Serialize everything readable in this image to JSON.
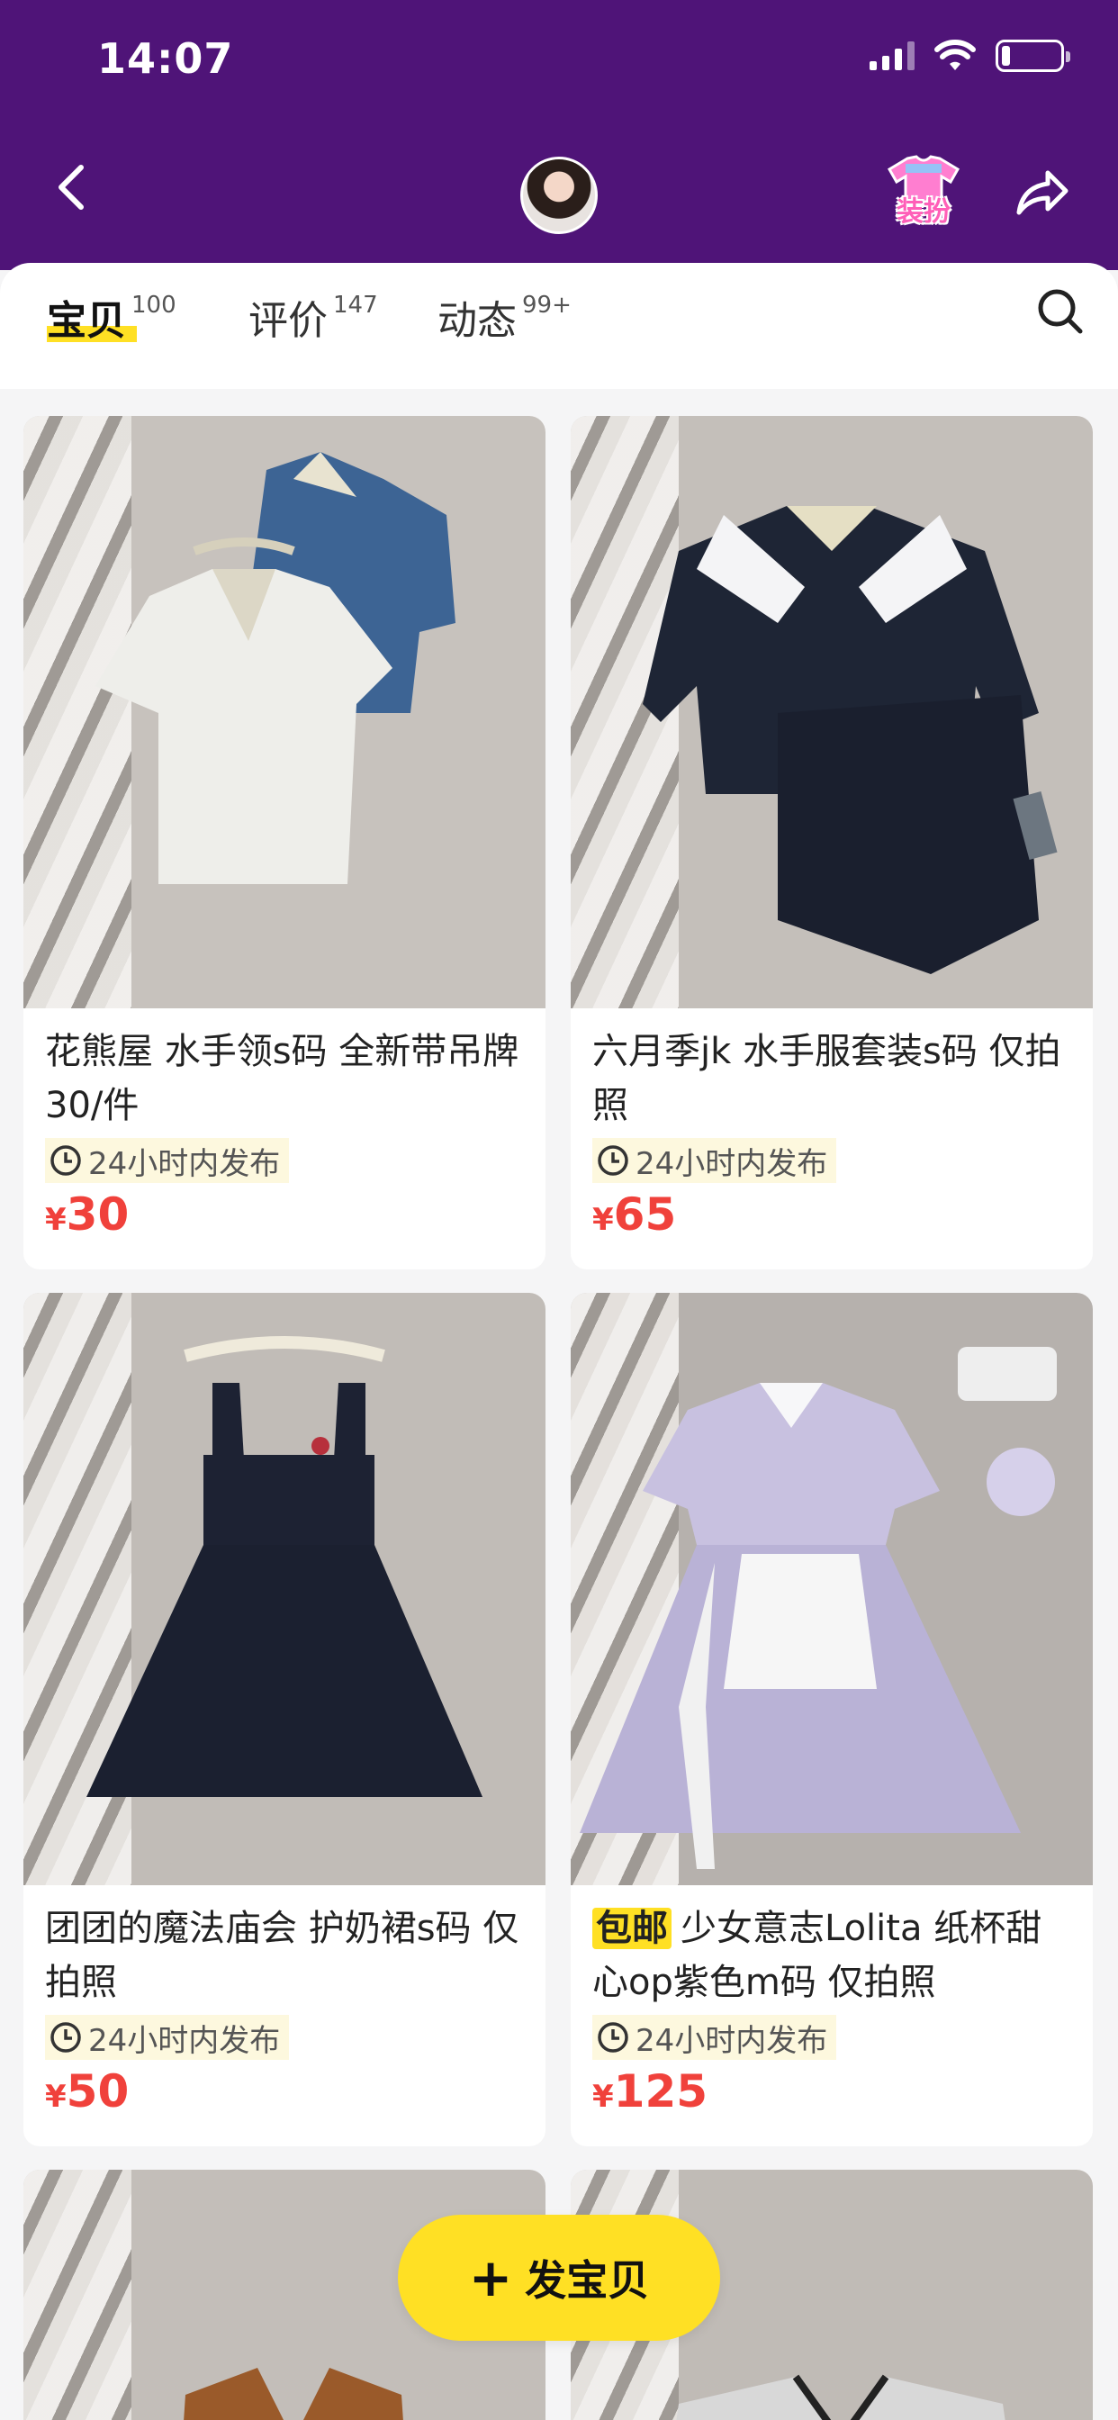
{
  "status": {
    "time": "14:07"
  },
  "header": {
    "dress_label": "装扮"
  },
  "tabs": [
    {
      "label": "宝贝",
      "count": "100"
    },
    {
      "label": "评价",
      "count": "147"
    },
    {
      "label": "动态",
      "count": "99+"
    }
  ],
  "items": [
    {
      "title": "花熊屋 水手领s码 全新带吊牌30/件",
      "time": "24小时内发布",
      "currency": "¥",
      "price": "30"
    },
    {
      "title": "六月季jk 水手服套装s码 仅拍照",
      "time": "24小时内发布",
      "currency": "¥",
      "price": "65"
    },
    {
      "title": "团团的魔法庙会 护奶裙s码 仅拍照",
      "time": "24小时内发布",
      "currency": "¥",
      "price": "50"
    },
    {
      "tag": "包邮",
      "title": "少女意志Lolita 纸杯甜心op紫色m码 仅拍照",
      "time": "24小时内发布",
      "currency": "¥",
      "price": "125"
    }
  ],
  "post_button": {
    "label": "发宝贝"
  },
  "colors": {
    "header": "#4f1478",
    "accent_yellow": "#ffe024",
    "price_red": "#f0413b"
  }
}
